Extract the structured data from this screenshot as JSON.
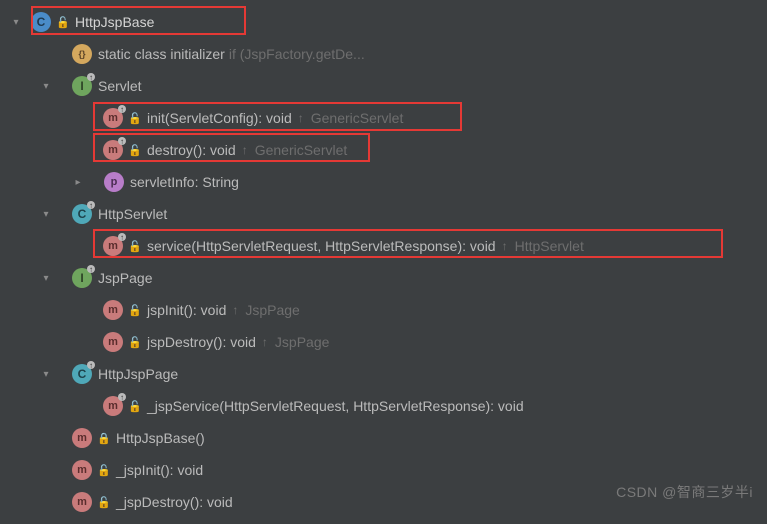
{
  "root": {
    "label": "HttpJspBase"
  },
  "initializer": {
    "label": "static class initializer",
    "hint": "if (JspFactory.getDe..."
  },
  "servlet": {
    "label": "Servlet",
    "init": {
      "sig": "init(ServletConfig): void",
      "from": "GenericServlet"
    },
    "destroy": {
      "sig": "destroy(): void",
      "from": "GenericServlet"
    },
    "info": {
      "sig": "servletInfo: String"
    }
  },
  "httpServlet": {
    "label": "HttpServlet",
    "service": {
      "sig": "service(HttpServletRequest, HttpServletResponse): void",
      "from": "HttpServlet"
    }
  },
  "jspPage": {
    "label": "JspPage",
    "jspInit": {
      "sig": "jspInit(): void",
      "from": "JspPage"
    },
    "jspDestroy": {
      "sig": "jspDestroy(): void",
      "from": "JspPage"
    }
  },
  "httpJspPage": {
    "label": "HttpJspPage",
    "jspService": {
      "sig": "_jspService(HttpServletRequest, HttpServletResponse): void"
    }
  },
  "members": {
    "ctor": {
      "sig": "HttpJspBase()"
    },
    "jspInit": {
      "sig": "_jspInit(): void"
    },
    "jspDestroy": {
      "sig": "_jspDestroy(): void"
    }
  },
  "watermark": "CSDN @智商三岁半i"
}
